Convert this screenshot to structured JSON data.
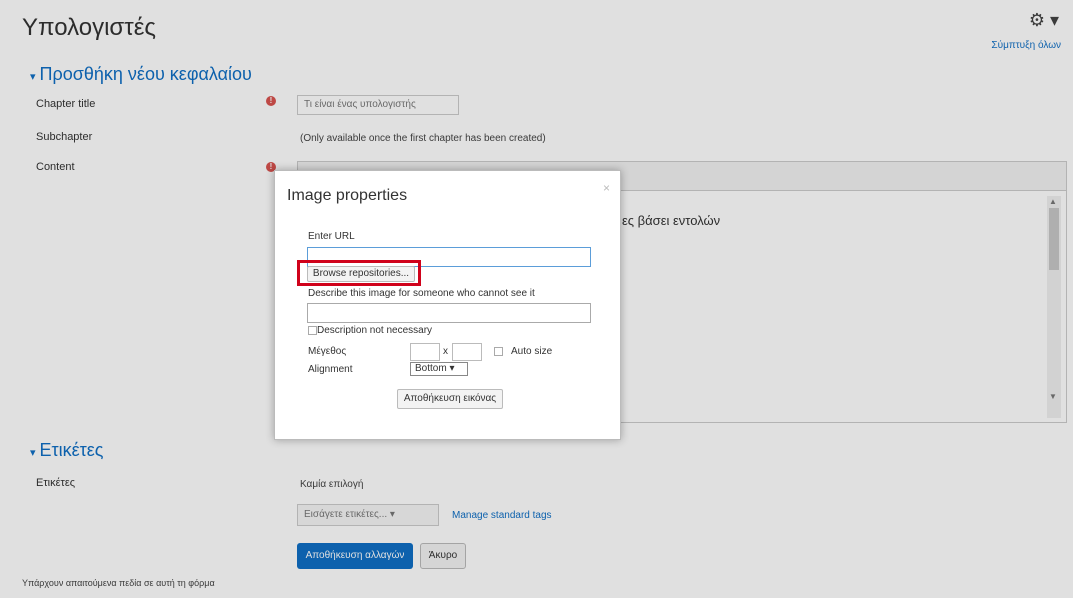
{
  "page": {
    "title": "Υπολογιστές",
    "gear_icon": "gear-icon",
    "collapse_all": "Σύμπτυξη όλων"
  },
  "section_chapter": {
    "heading": "Προσθήκη νέου κεφαλαίου",
    "chapter_title_label": "Chapter title",
    "chapter_title_value": "Τι είναι ένας υπολογιστής",
    "subchapter_label": "Subchapter",
    "subchapter_note": "(Only available once the first chapter has been created)",
    "content_label": "Content",
    "editor_text": "ες βάσει εντολών"
  },
  "section_tags": {
    "heading": "Ετικέτες",
    "tags_label": "Ετικέτες",
    "no_selection": "Καμία επιλογή",
    "tags_select_placeholder": "Εισάγετε ετικέτες...",
    "manage_tags_link": "Manage standard tags"
  },
  "actions": {
    "save_changes": "Αποθήκευση αλλαγών",
    "cancel": "Άκυρο"
  },
  "footer": {
    "required_note": "Υπάρχουν απαιτούμενα πεδία σε αυτή τη φόρμα"
  },
  "dialog": {
    "title": "Image properties",
    "close": "×",
    "enter_url_label": "Enter URL",
    "url_value": "",
    "browse_button": "Browse repositories...",
    "describe_label": "Describe this image for someone who cannot see it",
    "describe_value": "",
    "description_not_necessary": "Description not necessary",
    "size_label": "Μέγεθος",
    "size_x": "x",
    "auto_size": "Auto size",
    "alignment_label": "Alignment",
    "alignment_value": "Bottom",
    "save_image": "Αποθήκευση εικόνας"
  },
  "colors": {
    "link": "#0f6fc5",
    "required": "#d9534f",
    "highlight": "#d0021b"
  }
}
